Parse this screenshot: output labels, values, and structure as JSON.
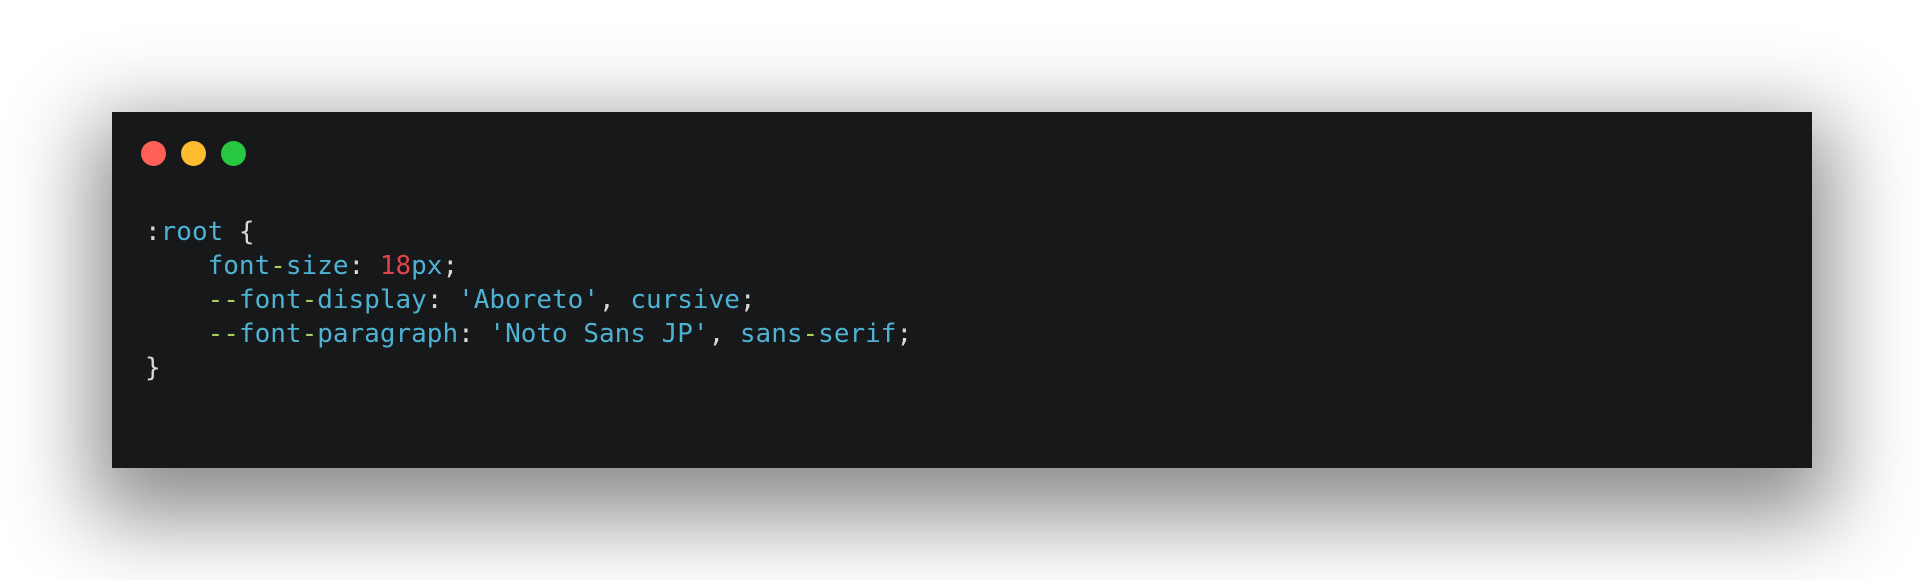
{
  "window": {
    "background": "#17181a",
    "controls": [
      {
        "name": "close",
        "color": "#fe5f57"
      },
      {
        "name": "minimize",
        "color": "#febc2e"
      },
      {
        "name": "zoom",
        "color": "#28c840"
      }
    ]
  },
  "colors": {
    "punct": "#d9d9d9",
    "ident": "#4eb3d3",
    "hyphen": "#a6d15a",
    "number": "#e0454b",
    "string": "#4eb3d3"
  },
  "code": {
    "lines": [
      [
        {
          "t": ":",
          "k": "punct"
        },
        {
          "t": "root",
          "k": "ident"
        },
        {
          "t": " {",
          "k": "punct"
        }
      ],
      [
        {
          "t": "    ",
          "k": "punct"
        },
        {
          "t": "font",
          "k": "ident"
        },
        {
          "t": "-",
          "k": "hyphen"
        },
        {
          "t": "size",
          "k": "ident"
        },
        {
          "t": ": ",
          "k": "punct"
        },
        {
          "t": "18",
          "k": "number"
        },
        {
          "t": "px",
          "k": "ident"
        },
        {
          "t": ";",
          "k": "punct"
        }
      ],
      [
        {
          "t": "    ",
          "k": "punct"
        },
        {
          "t": "--",
          "k": "hyphen"
        },
        {
          "t": "font",
          "k": "ident"
        },
        {
          "t": "-",
          "k": "hyphen"
        },
        {
          "t": "display",
          "k": "ident"
        },
        {
          "t": ": ",
          "k": "punct"
        },
        {
          "t": "'Aboreto'",
          "k": "string"
        },
        {
          "t": ", ",
          "k": "punct"
        },
        {
          "t": "cursive",
          "k": "ident"
        },
        {
          "t": ";",
          "k": "punct"
        }
      ],
      [
        {
          "t": "    ",
          "k": "punct"
        },
        {
          "t": "--",
          "k": "hyphen"
        },
        {
          "t": "font",
          "k": "ident"
        },
        {
          "t": "-",
          "k": "hyphen"
        },
        {
          "t": "paragraph",
          "k": "ident"
        },
        {
          "t": ": ",
          "k": "punct"
        },
        {
          "t": "'Noto Sans JP'",
          "k": "string"
        },
        {
          "t": ", ",
          "k": "punct"
        },
        {
          "t": "sans",
          "k": "ident"
        },
        {
          "t": "-",
          "k": "hyphen"
        },
        {
          "t": "serif",
          "k": "ident"
        },
        {
          "t": ";",
          "k": "punct"
        }
      ],
      [
        {
          "t": "}",
          "k": "punct"
        }
      ]
    ]
  }
}
